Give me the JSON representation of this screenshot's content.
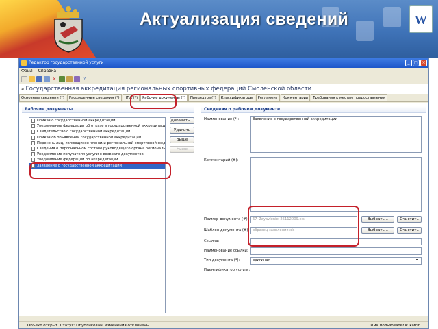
{
  "banner": {
    "title": "Актуализация сведений"
  },
  "window": {
    "title": "Редактор государственной услуги",
    "menu": [
      "Файл",
      "Справка"
    ],
    "doc_title": "Государственная аккредитация региональных спортивных федераций Смоленской области",
    "tabs": [
      "Основные сведения (*)",
      "Расширенные сведения (*)",
      "НПА (*)",
      "Рабочие документы (*)",
      "Процедуры(*)",
      "Классификаторы",
      "Регламент",
      "Комментарии",
      "Требования к местам предоставления"
    ]
  },
  "left_panel": {
    "header": "Рабочие документы",
    "items": [
      "Приказ о государственной аккредитации",
      "Уведомление федерации об отказе в государственной аккредитации",
      "Свидетельство о государственной аккредитации",
      "Приказ об объявлении государственной аккредитации",
      "Перечень лиц, являющихся членами региональной спортивной федерации",
      "Сведения о персональном составе руководящего органа региональной",
      "Уведомление получателя услуги о возврате документов",
      "Уведомление федерации об аккредитации",
      "Заявление о государственной аккредитации"
    ],
    "selected_index": 8,
    "buttons": [
      "Добавить...",
      "Удалить",
      "Выше",
      "Ниже"
    ]
  },
  "right_panel": {
    "header": "Сведения о рабочем документе",
    "name_label": "Наименование (*):",
    "name_value": "Заявление о государственной аккредитации",
    "comment_label": "Комментарий (#):",
    "example_label": "Пример документа (#):",
    "example_value": "67_Zayavlenie_25112009.xls",
    "template_label": "Шаблон документа (#):",
    "template_value": "образец заявления.xls",
    "select_label": "Выбрать...",
    "clear_label": "Очистить",
    "link_label": "Ссылка:",
    "link_name_label": "Наименование ссылки:",
    "doctype_label": "Тип документа (*):",
    "doctype_value": "оригинал",
    "service_id_label": "Идентификатор услуги:"
  },
  "status": {
    "left": "Объект открыт. Статус: Опубликован, изменения отклонены",
    "right": "Имя пользователя: katrin."
  }
}
